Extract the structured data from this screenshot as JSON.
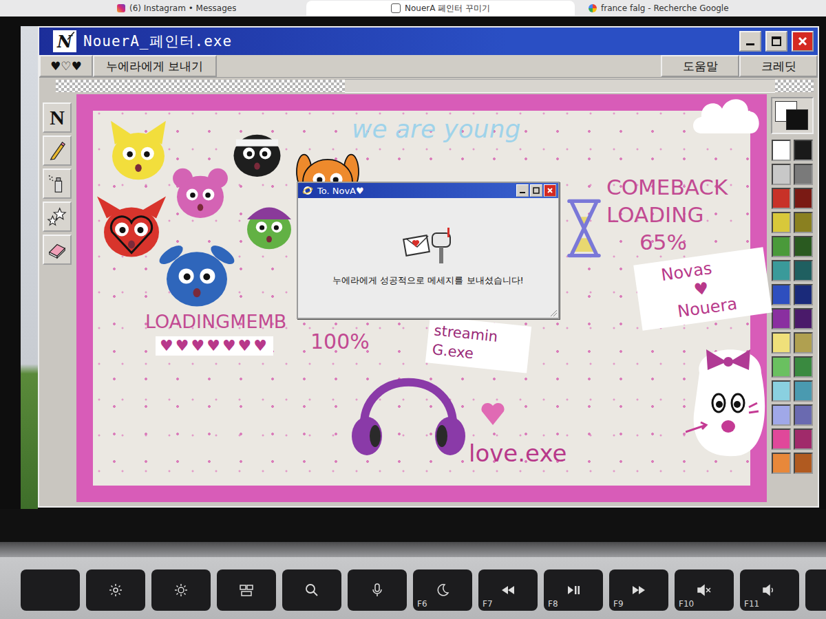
{
  "browser_tabs": [
    {
      "label": "(6) Instagram • Messages",
      "selected": false
    },
    {
      "label": "NouerA 페인터 꾸미기",
      "selected": true
    },
    {
      "label": "france falg - Recherche Google",
      "selected": false
    }
  ],
  "window": {
    "title": "NouerA_페인터.exe",
    "icon_letter": "N"
  },
  "menu": {
    "items": [
      "♥♡♥",
      "누에라에게 보내기"
    ],
    "right_items": [
      "도움말",
      "크레딧"
    ]
  },
  "tools": [
    {
      "kind": "text",
      "label": "N"
    },
    {
      "kind": "pencil"
    },
    {
      "kind": "spray"
    },
    {
      "kind": "stamp"
    },
    {
      "kind": "eraser"
    }
  ],
  "canvas": {
    "members": [
      {
        "kind": "cat",
        "color": "#f2de3c"
      },
      {
        "kind": "beanie",
        "color": "#1e1e1e"
      },
      {
        "kind": "mouse",
        "color": "#d463b4"
      },
      {
        "kind": "dog",
        "color": "#ee8a2c"
      },
      {
        "kind": "devil",
        "color": "#d8342c"
      },
      {
        "kind": "hat",
        "color": "#62b144"
      },
      {
        "kind": "bunny",
        "color": "#2f66bb"
      }
    ],
    "slogan": "we are young",
    "loading_members": {
      "label": "LOADINGMEMB",
      "hearts": "♥♥♥♥♥♥♥",
      "reading": "100%"
    },
    "comeback": {
      "lines": [
        "COMEBACK",
        "LOADING",
        "65%"
      ],
      "level": 0.65
    },
    "note": {
      "lines": [
        "Novas",
        "♥",
        "Nouera"
      ]
    },
    "streaming": {
      "lines": [
        "streamin",
        "G.exe"
      ]
    },
    "love": "love.exe"
  },
  "dialog": {
    "title": "To. NovA♥",
    "message": "누에라에게 성공적으로 메세지를 보내셨습니다!"
  },
  "palette": {
    "foreground": "#111111",
    "background": "#ffffff",
    "colors": [
      "#ffffff",
      "#1a1a1a",
      "#c8c8c8",
      "#7a7a7a",
      "#c83228",
      "#7a1a14",
      "#d8c83a",
      "#8a8020",
      "#4a9a3a",
      "#2a5a20",
      "#3a9a9a",
      "#1f5f60",
      "#2e4fbf",
      "#1a2a7a",
      "#8a2fa0",
      "#4a1a6a",
      "#efe07a",
      "#b0a050",
      "#6ac060",
      "#3a8a40",
      "#8ad0e0",
      "#4a9ab0",
      "#a0a8e8",
      "#6a6ab0",
      "#e0489a",
      "#a02a6a",
      "#e8883a",
      "#b05a20"
    ]
  },
  "keyboard": {
    "keys": [
      {
        "kind": "blank"
      },
      {
        "kind": "brightness-down"
      },
      {
        "kind": "brightness-up"
      },
      {
        "kind": "mission"
      },
      {
        "kind": "search"
      },
      {
        "kind": "mic"
      },
      {
        "kind": "moon",
        "label": "F6"
      },
      {
        "kind": "rewind",
        "label": "F7"
      },
      {
        "kind": "play",
        "label": "F8"
      },
      {
        "kind": "forward",
        "label": "F9"
      },
      {
        "kind": "mute",
        "label": "F10"
      },
      {
        "kind": "volume-down",
        "label": "F11"
      },
      {
        "kind": "volume-up"
      }
    ]
  }
}
